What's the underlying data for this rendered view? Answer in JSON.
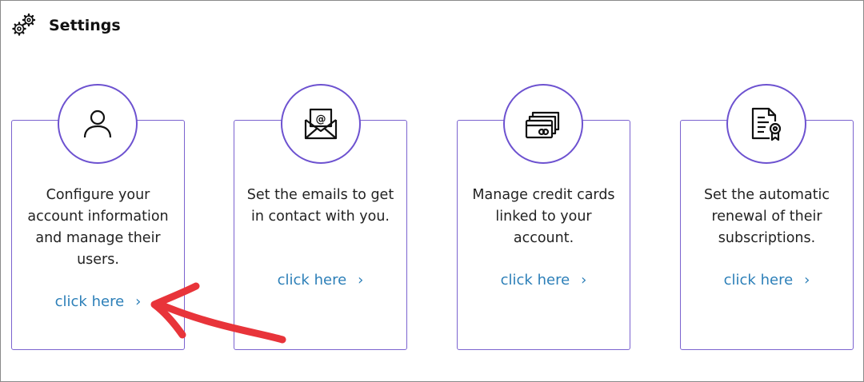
{
  "header": {
    "title": "Settings",
    "icon": "gears-icon"
  },
  "cards": [
    {
      "icon": "user-icon",
      "description": "Configure your account information and manage their users.",
      "link_label": "click here",
      "chevron": "›"
    },
    {
      "icon": "email-envelope-icon",
      "description": "Set the emails to get in contact with you.",
      "link_label": "click here",
      "chevron": "›"
    },
    {
      "icon": "credit-cards-icon",
      "description": "Manage credit cards linked to your account.",
      "link_label": "click here",
      "chevron": "›"
    },
    {
      "icon": "certificate-document-icon",
      "description": "Set the automatic renewal of their subscriptions.",
      "link_label": "click here",
      "chevron": "›"
    }
  ],
  "colors": {
    "card_border": "#7b63cf",
    "circle_border": "#6d52d0",
    "link": "#2c7fb8",
    "annotation_arrow": "#e8343a"
  }
}
